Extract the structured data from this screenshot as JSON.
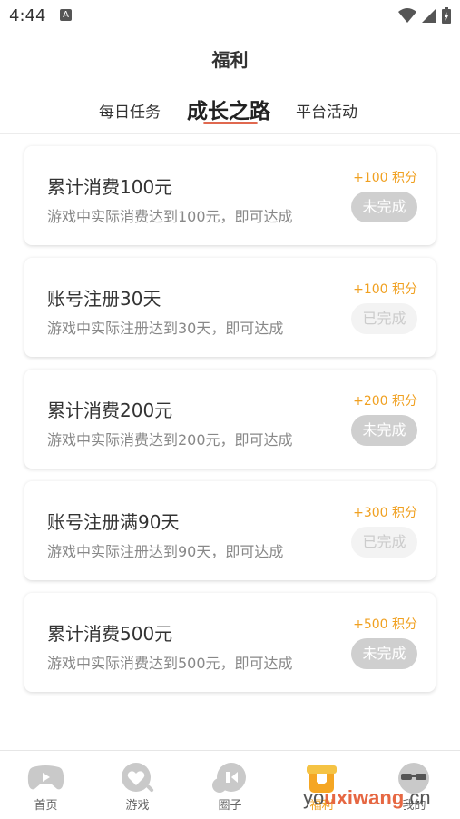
{
  "status_bar": {
    "time": "4:44",
    "notification_badge": "A"
  },
  "header": {
    "title": "福利"
  },
  "tabs": [
    {
      "label": "每日任务",
      "active": false
    },
    {
      "label": "成长之路",
      "active": true
    },
    {
      "label": "平台活动",
      "active": false
    }
  ],
  "tasks": [
    {
      "title": "累计消费100元",
      "desc": "游戏中实际消费达到100元，即可达成",
      "points": "+100 积分",
      "status": "未完成",
      "completed": false
    },
    {
      "title": "账号注册30天",
      "desc": "游戏中实际注册达到30天，即可达成",
      "points": "+100 积分",
      "status": "已完成",
      "completed": true
    },
    {
      "title": "累计消费200元",
      "desc": "游戏中实际消费达到200元，即可达成",
      "points": "+200 积分",
      "status": "未完成",
      "completed": false
    },
    {
      "title": "账号注册满90天",
      "desc": "游戏中实际注册达到90天，即可达成",
      "points": "+300 积分",
      "status": "已完成",
      "completed": true
    },
    {
      "title": "累计消费500元",
      "desc": "游戏中实际消费达到500元，即可达成",
      "points": "+500 积分",
      "status": "未完成",
      "completed": false
    }
  ],
  "bottom_nav": [
    {
      "label": "首页",
      "icon": "gamepad-icon",
      "active": false
    },
    {
      "label": "游戏",
      "icon": "heart-search-icon",
      "active": false
    },
    {
      "label": "圈子",
      "icon": "chat-icon",
      "active": false
    },
    {
      "label": "福利",
      "icon": "gift-icon",
      "active": true
    },
    {
      "label": "我的",
      "icon": "sunglasses-face-icon",
      "active": false
    }
  ],
  "watermark": {
    "text_prefix": "yo",
    "text_mid": "uxiwang",
    "text_suffix": ".cn"
  },
  "colors": {
    "accent": "#f0a020",
    "tab_underline": "#e0684f",
    "pill_incomplete": "#cfcfcf",
    "pill_complete": "#f3f3f3"
  }
}
